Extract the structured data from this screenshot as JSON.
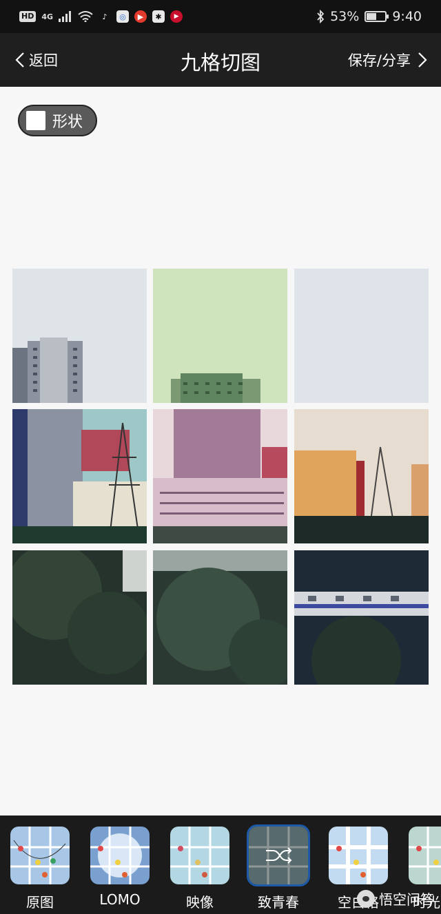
{
  "status_bar": {
    "hd": "HD",
    "network": "4G",
    "battery_percent_text": "53%",
    "battery_level": 0.53,
    "time": "9:40"
  },
  "header": {
    "back_label": "返回",
    "title": "九格切图",
    "save_label": "保存/分享"
  },
  "shape_button": {
    "label": "形状"
  },
  "filters": [
    {
      "label": "原图",
      "selected": false
    },
    {
      "label": "LOMO",
      "selected": false
    },
    {
      "label": "映像",
      "selected": false
    },
    {
      "label": "致青春",
      "selected": true
    },
    {
      "label": "空白格",
      "selected": false
    },
    {
      "label": "时光",
      "selected": false
    }
  ],
  "watermark": {
    "text": "悟空问答"
  }
}
